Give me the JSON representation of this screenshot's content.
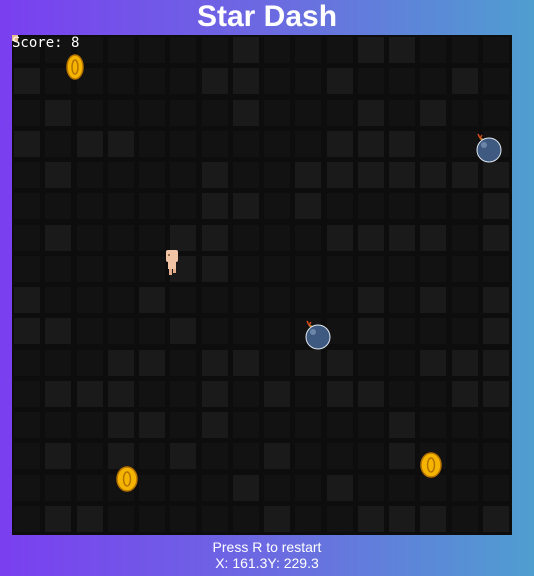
{
  "game": {
    "title": "Star Dash",
    "score_label": "Score:",
    "score": "8"
  },
  "footer": {
    "restart_hint": "Press R to restart",
    "x_label": "X:",
    "x_value": "161.3",
    "y_label": "Y:",
    "y_value": "229.3"
  },
  "colors": {
    "board_bg": "#0d0d0d",
    "tile_dark": "#121212",
    "tile_light": "#1a1a1a",
    "coin": "#f5b400",
    "coin_rim": "#b57300",
    "bomb": "#3f5a80",
    "player_skin": "#f2c4a6"
  },
  "icons": {
    "player": "player-sprite",
    "coin": "coin-icon",
    "bomb": "bomb-icon"
  }
}
